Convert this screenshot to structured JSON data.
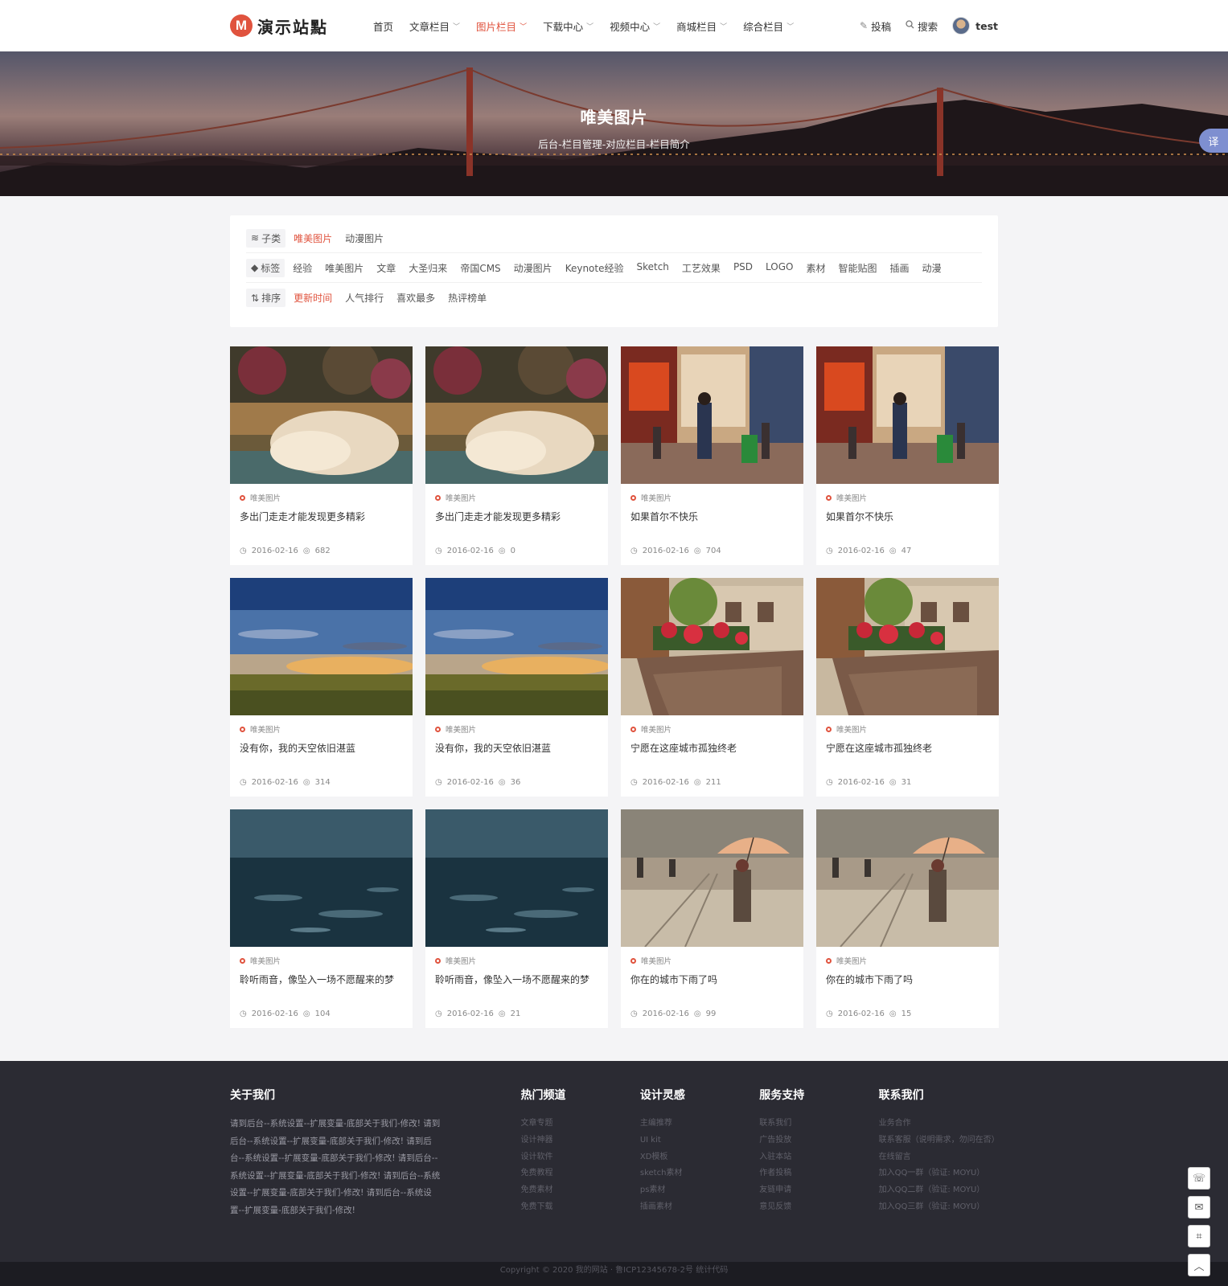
{
  "header": {
    "logo_mark": "M",
    "logo_text": "演示站點",
    "nav": [
      {
        "label": "首页",
        "dropdown": false,
        "active": false
      },
      {
        "label": "文章栏目",
        "dropdown": true,
        "active": false
      },
      {
        "label": "图片栏目",
        "dropdown": true,
        "active": true
      },
      {
        "label": "下载中心",
        "dropdown": true,
        "active": false
      },
      {
        "label": "视频中心",
        "dropdown": true,
        "active": false
      },
      {
        "label": "商城栏目",
        "dropdown": true,
        "active": false
      },
      {
        "label": "综合栏目",
        "dropdown": true,
        "active": false
      }
    ],
    "submit_label": "投稿",
    "search_label": "搜索",
    "username": "test"
  },
  "banner": {
    "title": "唯美图片",
    "subtitle": "后台-栏目管理-对应栏目-栏目简介",
    "translate_label": "译"
  },
  "filter": {
    "subcat_label": "子类",
    "subcats": [
      "唯美图片",
      "动漫图片"
    ],
    "subcat_active": 0,
    "tag_label": "标签",
    "tags": [
      "经验",
      "唯美图片",
      "文章",
      "大圣归来",
      "帝国CMS",
      "动漫图片",
      "Keynote经验",
      "Sketch",
      "工艺效果",
      "PSD",
      "LOGO",
      "素材",
      "智能贴图",
      "插画",
      "动漫"
    ],
    "sort_label": "排序",
    "sorts": [
      "更新时间",
      "人气排行",
      "喜欢最多",
      "热评榜单"
    ],
    "sort_active": 0
  },
  "cards": [
    {
      "category": "唯美图片",
      "title": "多出门走走才能发现更多精彩",
      "date": "2016-02-16",
      "views": "682",
      "image": "grass"
    },
    {
      "category": "唯美图片",
      "title": "多出门走走才能发现更多精彩",
      "date": "2016-02-16",
      "views": "0",
      "image": "grass"
    },
    {
      "category": "唯美图片",
      "title": "如果首尔不快乐",
      "date": "2016-02-16",
      "views": "704",
      "image": "street"
    },
    {
      "category": "唯美图片",
      "title": "如果首尔不快乐",
      "date": "2016-02-16",
      "views": "47",
      "image": "street"
    },
    {
      "category": "唯美图片",
      "title": "没有你，我的天空依旧湛蓝",
      "date": "2016-02-16",
      "views": "314",
      "image": "sky"
    },
    {
      "category": "唯美图片",
      "title": "没有你，我的天空依旧湛蓝",
      "date": "2016-02-16",
      "views": "36",
      "image": "sky"
    },
    {
      "category": "唯美图片",
      "title": "宁愿在这座城市孤独终老",
      "date": "2016-02-16",
      "views": "211",
      "image": "flowers"
    },
    {
      "category": "唯美图片",
      "title": "宁愿在这座城市孤独终老",
      "date": "2016-02-16",
      "views": "31",
      "image": "flowers"
    },
    {
      "category": "唯美图片",
      "title": "聆听雨音，像坠入一场不愿醒来的梦",
      "date": "2016-02-16",
      "views": "104",
      "image": "rain"
    },
    {
      "category": "唯美图片",
      "title": "聆听雨音，像坠入一场不愿醒来的梦",
      "date": "2016-02-16",
      "views": "21",
      "image": "rain"
    },
    {
      "category": "唯美图片",
      "title": "你在的城市下雨了吗",
      "date": "2016-02-16",
      "views": "99",
      "image": "umbrella"
    },
    {
      "category": "唯美图片",
      "title": "你在的城市下雨了吗",
      "date": "2016-02-16",
      "views": "15",
      "image": "umbrella"
    }
  ],
  "footer": {
    "about_title": "关于我们",
    "about_text": "请到后台--系统设置--扩展变量-底部关于我们-修改! 请到后台--系统设置--扩展变量-底部关于我们-修改! 请到后台--系统设置--扩展变量-底部关于我们-修改! 请到后台--系统设置--扩展变量-底部关于我们-修改! 请到后台--系统设置--扩展变量-底部关于我们-修改! 请到后台--系统设置--扩展变量-底部关于我们-修改!",
    "columns": [
      {
        "title": "热门频道",
        "items": [
          "文章专题",
          "设计神器",
          "设计软件",
          "免费教程",
          "免费素材",
          "免费下载"
        ]
      },
      {
        "title": "设计灵感",
        "items": [
          "主编推荐",
          "UI kit",
          "XD模板",
          "sketch素材",
          "ps素材",
          "插画素材"
        ]
      },
      {
        "title": "服务支持",
        "items": [
          "联系我们",
          "广告投放",
          "入驻本站",
          "作者投稿",
          "友链申请",
          "意见反馈"
        ]
      },
      {
        "title": "联系我们",
        "items": [
          "业务合作",
          "联系客服（说明需求，勿问在否）",
          "在线留言",
          "加入QQ一群（验证: MOYU）",
          "加入QQ二群（验证: MOYU）",
          "加入QQ三群（验证: MOYU）"
        ]
      }
    ],
    "copyright": "Copyright © 2020 我的网站 · 鲁ICP12345678-2号 统计代码"
  },
  "colors": {
    "accent": "#e0533e",
    "footer_bg": "#2b2b33",
    "page_bg": "#f4f4f6"
  },
  "icons": {
    "submit": "pencil-icon",
    "search": "search-icon",
    "subcat": "layers-icon",
    "tag": "tag-icon",
    "sort": "sort-icon",
    "date": "clock-icon",
    "views": "eye-icon"
  },
  "side_tools": [
    "qq-icon",
    "wechat-icon",
    "scan-icon",
    "back-to-top-icon"
  ]
}
